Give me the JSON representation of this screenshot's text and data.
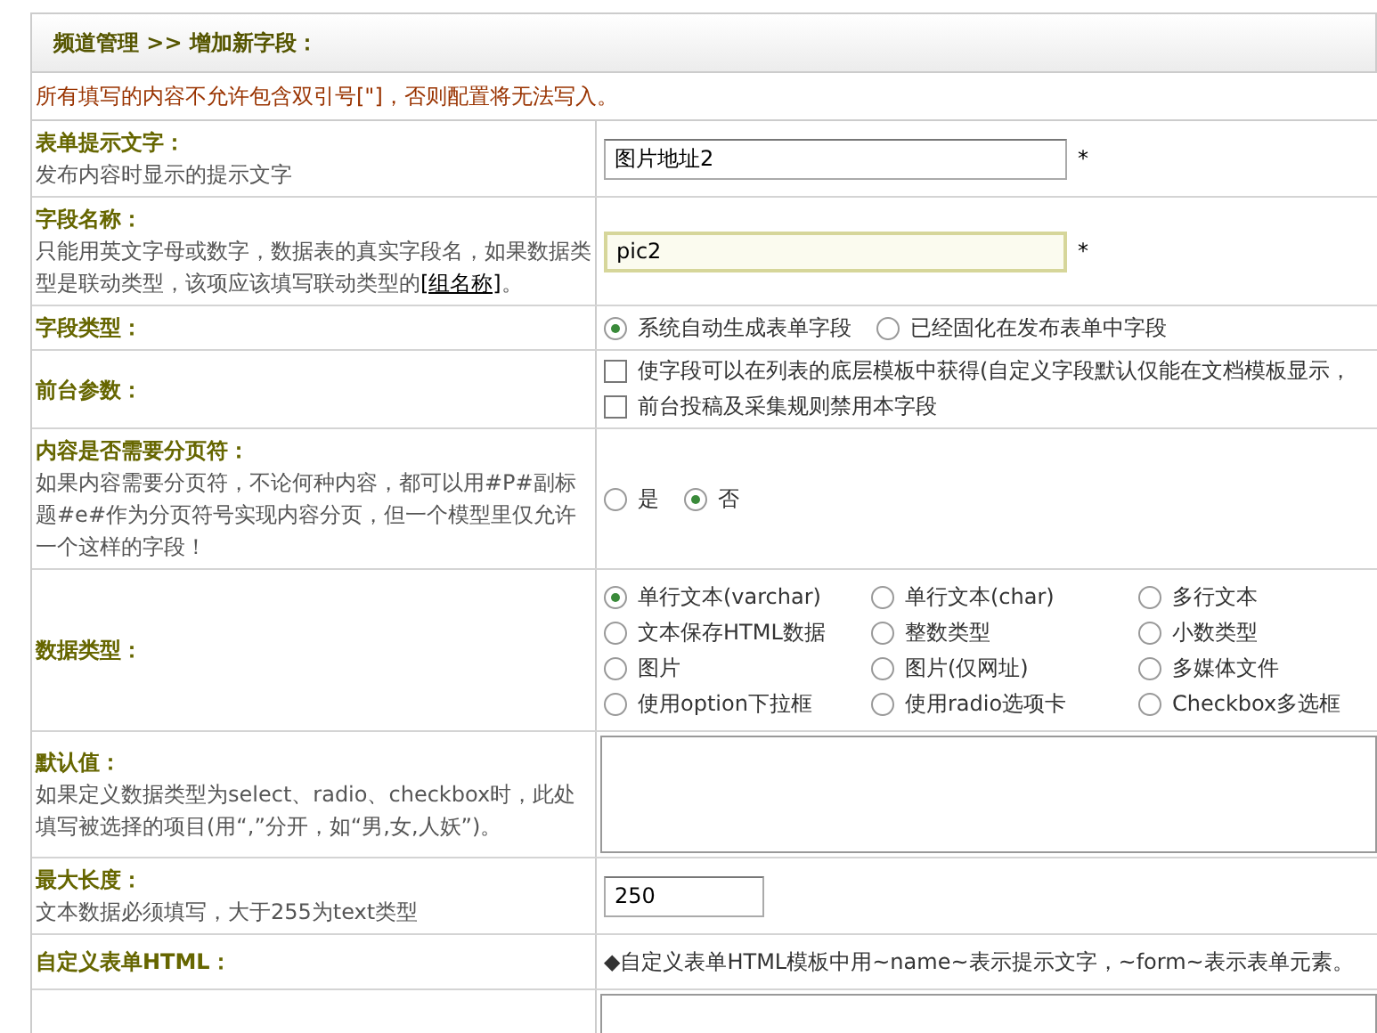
{
  "header": {
    "breadcrumb": "频道管理 >> 增加新字段："
  },
  "notice": "所有填写的内容不允许包含双引号[\"]，否则配置将无法写入。",
  "rows": [
    {
      "kind": "text",
      "label": "表单提示文字：",
      "desc": "发布内容时显示的提示文字",
      "value": "图片地址2",
      "focused": false,
      "required": "*"
    },
    {
      "kind": "text",
      "label": "字段名称：",
      "desc": "只能用英文字母或数字，数据表的真实字段名，如果数据类型是联动类型，该项应该填写联动类型的",
      "desc_link": "[组名称]",
      "desc_end": "。",
      "value": "pic2",
      "focused": true,
      "required": "*"
    },
    {
      "kind": "radio",
      "label": "字段类型：",
      "options": [
        {
          "label": "系统自动生成表单字段",
          "selected": true
        },
        {
          "label": "已经固化在发布表单中字段",
          "selected": false
        }
      ]
    },
    {
      "kind": "checkbox",
      "label": "前台参数：",
      "options": [
        {
          "label": "使字段可以在列表的底层模板中获得(自定义字段默认仅能在文档模板显示，",
          "checked": false
        },
        {
          "label": "前台投稿及采集规则禁用本字段",
          "checked": false
        }
      ]
    },
    {
      "kind": "radio",
      "label": "内容是否需要分页符：",
      "desc": "如果内容需要分页符，不论何种内容，都可以用#P#副标题#e#作为分页符号实现内容分页，但一个模型里仅允许一个这样的字段！",
      "options": [
        {
          "label": "是",
          "selected": false
        },
        {
          "label": "否",
          "selected": true
        }
      ]
    },
    {
      "kind": "radio_grid",
      "label": "数据类型：",
      "options": [
        {
          "label": "单行文本(varchar)",
          "selected": true
        },
        {
          "label": "单行文本(char)",
          "selected": false
        },
        {
          "label": "多行文本",
          "selected": false
        },
        {
          "label": "文本保存HTML数据",
          "selected": false
        },
        {
          "label": "整数类型",
          "selected": false
        },
        {
          "label": "小数类型",
          "selected": false
        },
        {
          "label": "图片",
          "selected": false
        },
        {
          "label": "图片(仅网址)",
          "selected": false
        },
        {
          "label": "多媒体文件",
          "selected": false
        },
        {
          "label": "使用option下拉框",
          "selected": false
        },
        {
          "label": "使用radio选项卡",
          "selected": false
        },
        {
          "label": "Checkbox多选框",
          "selected": false
        }
      ]
    },
    {
      "kind": "textarea",
      "label": "默认值：",
      "desc": "如果定义数据类型为select、radio、checkbox时，此处填写被选择的项目(用“,”分开，如“男,女,人妖”)。"
    },
    {
      "kind": "short_text",
      "label": "最大长度：",
      "desc": "文本数据必须填写，大于255为text类型",
      "value": "250",
      "focused": false
    },
    {
      "kind": "note",
      "label": "自定义表单HTML：",
      "note": "◆自定义表单HTML模板中用~name~表示提示文字，~form~表示表单元素。"
    },
    {
      "kind": "textarea"
    }
  ]
}
